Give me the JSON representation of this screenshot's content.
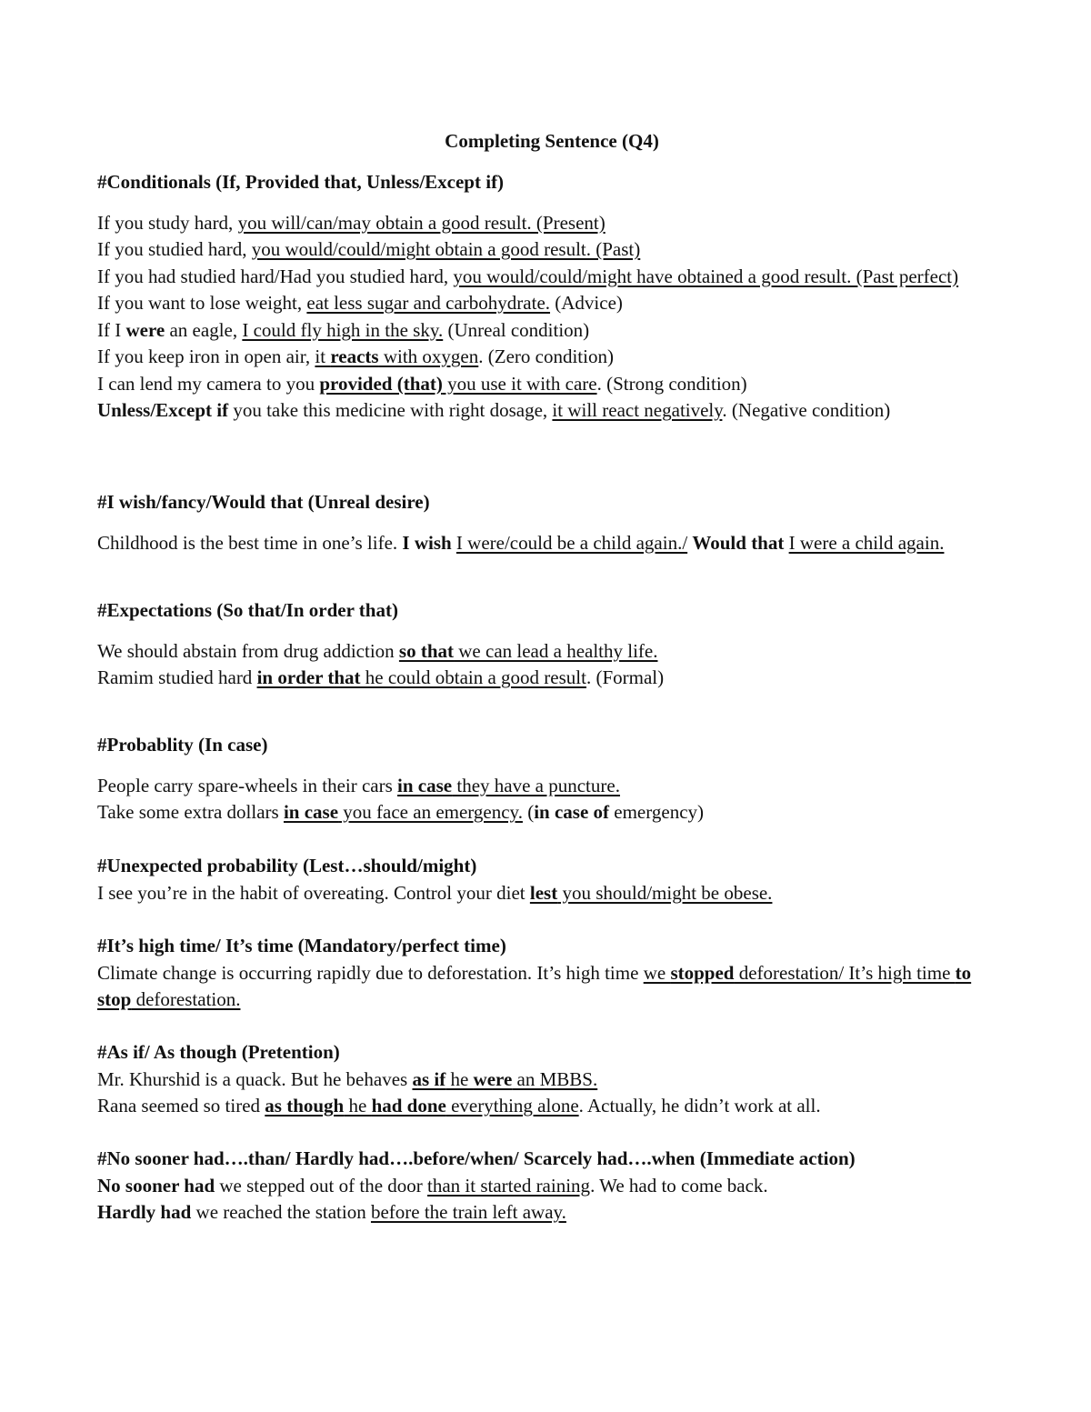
{
  "document": {
    "title": "Completing Sentence (Q4)",
    "sections": [
      {
        "heading": "#Conditionals (If, Provided that, Unless/Except if)",
        "gap_after_heading": true,
        "lines": [
          [
            {
              "t": "If you study hard, "
            },
            {
              "t": "you will/can/may obtain a good result. (Present)",
              "u": true
            }
          ],
          [
            {
              "t": "If you studied hard, "
            },
            {
              "t": "you would/could/might obtain a good result. (Past)",
              "u": true
            }
          ],
          [
            {
              "t": "If you had studied hard/Had you studied hard, "
            },
            {
              "t": "you would/could/might have obtained a good result. (Past perfect)",
              "u": true
            }
          ],
          [
            {
              "t": "If you want to lose weight, "
            },
            {
              "t": "eat less sugar and carbohydrate.",
              "u": true
            },
            {
              "t": " (Advice)"
            }
          ],
          [
            {
              "t": "If I "
            },
            {
              "t": "were",
              "b": true
            },
            {
              "t": " an eagle, "
            },
            {
              "t": "I could fly high in the sky.",
              "u": true
            },
            {
              "t": " (Unreal condition)"
            }
          ],
          [
            {
              "t": "If you keep iron in open air, "
            },
            {
              "t": "it ",
              "u": true
            },
            {
              "t": "reacts",
              "u": true,
              "b": true
            },
            {
              "t": " with oxygen",
              "u": true
            },
            {
              "t": ". (Zero condition)"
            }
          ],
          [
            {
              "t": "I can lend my camera to you "
            },
            {
              "t": "provided (that)",
              "u": true,
              "b": true
            },
            {
              "t": " you use it with care",
              "u": true
            },
            {
              "t": ". (Strong condition)"
            }
          ],
          [
            {
              "t": "Unless/Except if",
              "b": true
            },
            {
              "t": " you take this medicine with right dosage, "
            },
            {
              "t": "it will react negatively",
              "u": true
            },
            {
              "t": ". (Negative condition)"
            }
          ]
        ]
      },
      {
        "heading": "#I wish/fancy/Would that (Unreal desire)",
        "gap_after_heading": true,
        "lines": [
          [
            {
              "t": "Childhood is the best time in one’s life. "
            },
            {
              "t": "I wish",
              "b": true
            },
            {
              "t": " "
            },
            {
              "t": "I were/could be a child again./",
              "u": true
            },
            {
              "t": " "
            },
            {
              "t": "Would that",
              "b": true
            },
            {
              "t": " "
            },
            {
              "t": "I were a child again.",
              "u": true
            }
          ]
        ]
      },
      {
        "heading": "#Expectations (So that/In order that)",
        "gap_after_heading": true,
        "lines": [
          [
            {
              "t": "We should abstain from drug addiction "
            },
            {
              "t": "so that",
              "u": true,
              "b": true
            },
            {
              "t": " we can lead a healthy life.",
              "u": true
            }
          ],
          [
            {
              "t": "Ramim studied hard "
            },
            {
              "t": "in order that",
              "u": true,
              "b": true
            },
            {
              "t": " he could obtain a good result",
              "u": true
            },
            {
              "t": ". (Formal)"
            }
          ]
        ]
      },
      {
        "heading": "#Probablity (In case)",
        "gap_after_heading": true,
        "lines": [
          [
            {
              "t": "People carry spare-wheels in their cars "
            },
            {
              "t": "in case",
              "u": true,
              "b": true
            },
            {
              "t": " they have a puncture.",
              "u": true
            }
          ],
          [
            {
              "t": "Take some extra dollars "
            },
            {
              "t": "in case",
              "u": true,
              "b": true
            },
            {
              "t": " you face an emergency.",
              "u": true
            },
            {
              "t": " ("
            },
            {
              "t": "in case of",
              "b": true
            },
            {
              "t": " emergency)"
            }
          ]
        ]
      },
      {
        "heading": "#Unexpected probability (Lest…should/might)",
        "gap_after_heading": false,
        "lines": [
          [
            {
              "t": "I see you’re in the habit of overeating. Control your diet "
            },
            {
              "t": "lest",
              "u": true,
              "b": true
            },
            {
              "t": " you should/might be obese.",
              "u": true
            }
          ]
        ]
      },
      {
        "heading": "#It’s high time/ It’s time (Mandatory/perfect time)",
        "gap_after_heading": false,
        "lines": [
          [
            {
              "t": "Climate change is occurring rapidly due to deforestation. It’s high time "
            },
            {
              "t": "we ",
              "u": true
            },
            {
              "t": "stopped",
              "u": true,
              "b": true
            },
            {
              "t": " deforestation/ It’s high time ",
              "u": true
            },
            {
              "t": "to stop",
              "u": true,
              "b": true
            },
            {
              "t": " deforestation.",
              "u": true
            }
          ]
        ]
      },
      {
        "heading": "#As if/ As though (Pretention)",
        "gap_after_heading": false,
        "lines": [
          [
            {
              "t": "Mr. Khurshid is a quack. But he behaves "
            },
            {
              "t": "as if",
              "u": true,
              "b": true
            },
            {
              "t": " he ",
              "u": true
            },
            {
              "t": "were",
              "u": true,
              "b": true
            },
            {
              "t": " an MBBS.",
              "u": true
            }
          ],
          [
            {
              "t": "Rana seemed so tired "
            },
            {
              "t": "as though",
              "u": true,
              "b": true
            },
            {
              "t": " he ",
              "u": true
            },
            {
              "t": "had done",
              "u": true,
              "b": true
            },
            {
              "t": " everything alone",
              "u": true
            },
            {
              "t": ". Actually, he didn’t work at all."
            }
          ]
        ]
      },
      {
        "heading": "#No sooner had….than/ Hardly had….before/when/ Scarcely had….when (Immediate action)",
        "gap_after_heading": false,
        "lines": [
          [
            {
              "t": "No sooner had",
              "b": true
            },
            {
              "t": " we stepped out of the door "
            },
            {
              "t": "than it started raining",
              "u": true
            },
            {
              "t": ". We had to come back."
            }
          ],
          [
            {
              "t": "Hardly had",
              "b": true
            },
            {
              "t": " we reached the station "
            },
            {
              "t": "before the train left away.",
              "u": true
            }
          ]
        ]
      }
    ]
  }
}
